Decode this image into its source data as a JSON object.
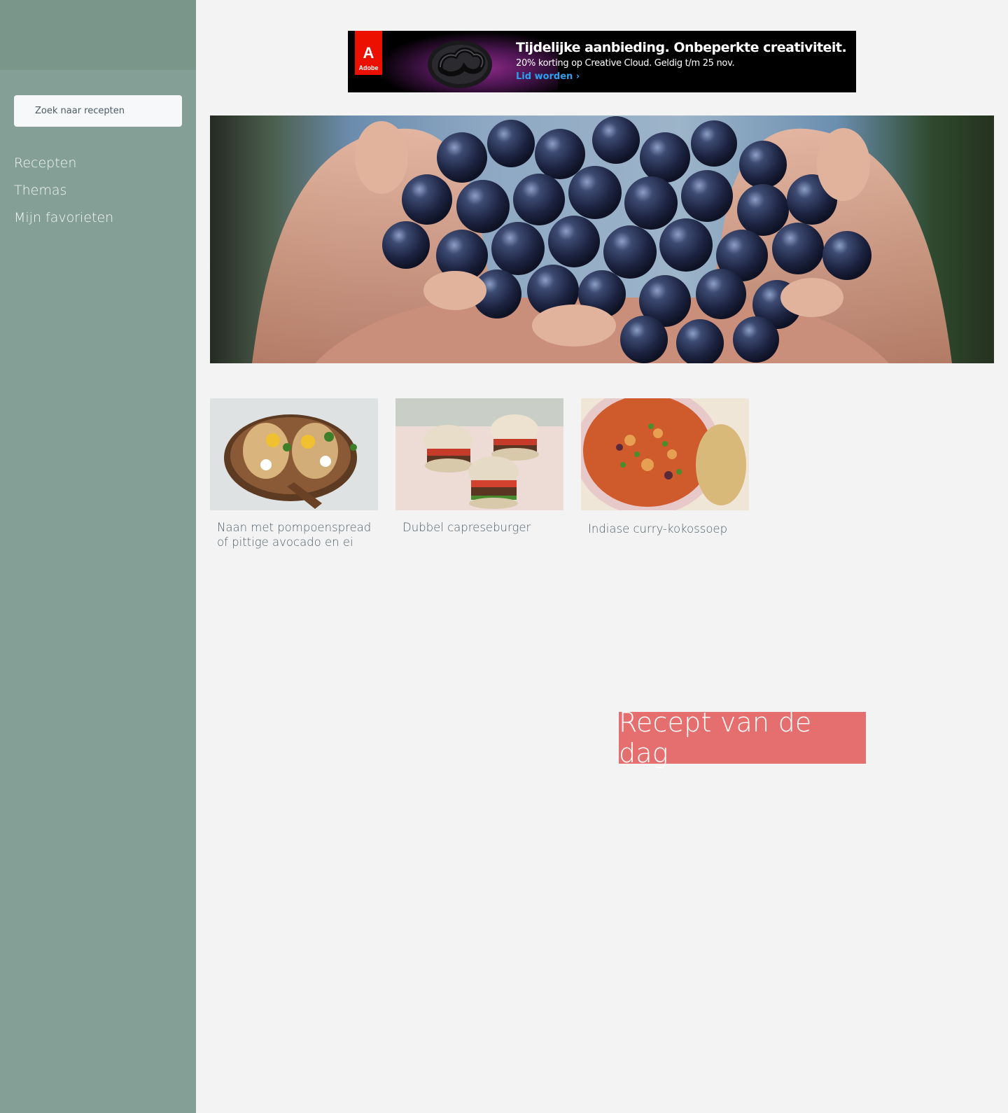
{
  "sidebar": {
    "search": {
      "placeholder": "Zoek naar recepten"
    },
    "nav": [
      {
        "label": "Recepten"
      },
      {
        "label": "Themas"
      },
      {
        "label": "Mijn favorieten"
      }
    ]
  },
  "ad": {
    "brand": "Adobe",
    "headline": "Tijdelijke aanbieding. Onbeperkte creativiteit.",
    "subline": "20% korting op Creative Cloud. Geldig t/m 25 nov.",
    "cta": "Lid worden ›"
  },
  "recipes": [
    {
      "title": "Naan met pompoenspread of pittige avocado en ei"
    },
    {
      "title": "Dubbel capreseburger"
    },
    {
      "title": "Indiase curry-kokossoep"
    }
  ],
  "recipe_of_day": {
    "label": "Recept van de dag"
  },
  "colors": {
    "sidebar": "#849f95",
    "sidebar_top": "#7a958a",
    "background": "#f3f3f3",
    "accent": "#e56f6f",
    "ad_brand": "#eb1000",
    "ad_cta": "#2da0f0"
  }
}
